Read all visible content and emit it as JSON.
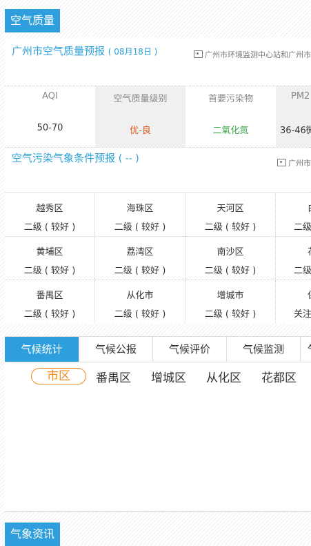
{
  "air_section": {
    "tag": "空气质量"
  },
  "forecast": {
    "city_title": "广州市空气质量预报",
    "date": "( 08月18日 )",
    "source": "广州市环境监测中心站和广州市",
    "columns": [
      {
        "header": "AQI",
        "value": "50-70"
      },
      {
        "header": "空气质量级别",
        "value": "优-良"
      },
      {
        "header": "首要污染物",
        "value": "二氧化氮"
      },
      {
        "header": "PM2",
        "value": "36-46微"
      }
    ]
  },
  "meteo": {
    "title": "空气污染气象条件预报",
    "date": "( -- )",
    "source": "广州市"
  },
  "districts": [
    {
      "name": "越秀区",
      "grade": "二级 ( 较好 )"
    },
    {
      "name": "海珠区",
      "grade": "二级 ( 较好 )"
    },
    {
      "name": "天河区",
      "grade": "二级 ( 较好 )"
    },
    {
      "name": "白",
      "grade": "二级"
    },
    {
      "name": "黄埔区",
      "grade": "二级 ( 较好 )"
    },
    {
      "name": "荔湾区",
      "grade": "二级 ( 较好 )"
    },
    {
      "name": "南沙区",
      "grade": "二级 ( 较好 )"
    },
    {
      "name": "花",
      "grade": "二级"
    },
    {
      "name": "番禺区",
      "grade": "二级 ( 较好 )"
    },
    {
      "name": "从化市",
      "grade": "二级 ( 较好 )"
    },
    {
      "name": "增城市",
      "grade": "二级 ( 较好 )"
    },
    {
      "name": "保",
      "grade": "关注"
    }
  ],
  "climate": {
    "tabs": [
      "气候统计",
      "气候公报",
      "气候评价",
      "气候监测",
      "气"
    ],
    "subtabs": [
      "市区",
      "番禺区",
      "增城区",
      "从化区",
      "花都区"
    ]
  },
  "news_section": {
    "tag": "气象资讯"
  },
  "colors": {
    "accent": "#2e9fdc",
    "good": "#e0531c",
    "pollutant": "#3fa94d",
    "active_sub": "#f08a1c"
  }
}
